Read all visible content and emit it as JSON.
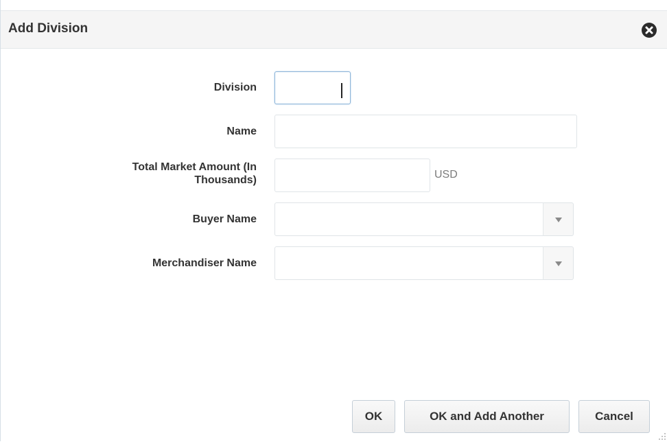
{
  "dialog": {
    "title": "Add Division"
  },
  "form": {
    "division": {
      "label": "Division",
      "value": ""
    },
    "name": {
      "label": "Name",
      "value": ""
    },
    "total_market_amount": {
      "label_line1": "Total Market Amount (In",
      "label_line2": "Thousands)",
      "value": "",
      "unit": "USD"
    },
    "buyer_name": {
      "label": "Buyer Name",
      "value": ""
    },
    "merchandiser_name": {
      "label": "Merchandiser Name",
      "value": ""
    }
  },
  "buttons": {
    "ok": "OK",
    "ok_add_another": "OK and Add Another",
    "cancel": "Cancel"
  },
  "icons": {
    "close": "close-icon",
    "dropdown": "chevron-down-icon",
    "resize": "resize-grip-icon"
  }
}
